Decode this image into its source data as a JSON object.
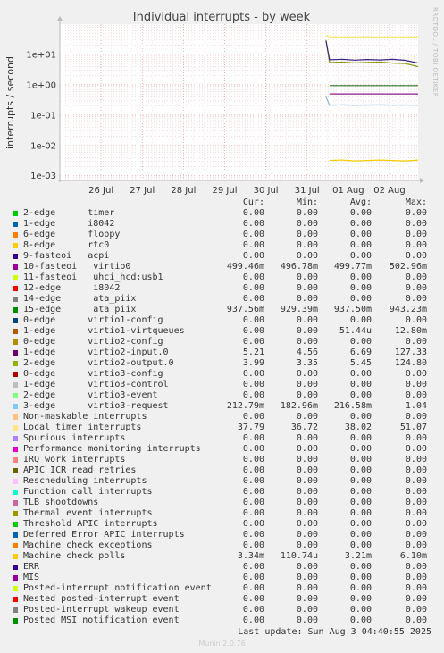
{
  "chart_data": {
    "type": "line",
    "title": "Individual interrupts - by week",
    "ylabel": "interrupts / second",
    "yscale": "log",
    "ylim": [
      0.0007,
      100
    ],
    "yticks": [
      {
        "v": 10,
        "label": "1e+01"
      },
      {
        "v": 1,
        "label": "1e+00"
      },
      {
        "v": 0.1,
        "label": "1e-01"
      },
      {
        "v": 0.01,
        "label": "1e-02"
      },
      {
        "v": 0.001,
        "label": "1e-03"
      }
    ],
    "xlim": [
      "2025-07-25T12:00",
      "2025-08-03T04:40"
    ],
    "xticks": [
      {
        "t": "2025-07-26T12:00",
        "label": "26 Jul"
      },
      {
        "t": "2025-07-27T12:00",
        "label": "27 Jul"
      },
      {
        "t": "2025-07-28T12:00",
        "label": "28 Jul"
      },
      {
        "t": "2025-07-29T12:00",
        "label": "29 Jul"
      },
      {
        "t": "2025-07-30T12:00",
        "label": "30 Jul"
      },
      {
        "t": "2025-07-31T12:00",
        "label": "31 Jul"
      },
      {
        "t": "2025-08-01T12:00",
        "label": "01 Aug"
      },
      {
        "t": "2025-08-02T12:00",
        "label": "02 Aug"
      }
    ],
    "grid": true,
    "series": [
      {
        "name": "Local timer interrupts",
        "color": "#f8e45c",
        "start": "2025-07-31T23:00",
        "peak": 43,
        "values": [
          37.8,
          38.0,
          37.9,
          38.1,
          37.9,
          38.0,
          38.0,
          37.8
        ]
      },
      {
        "name": "2-edge virtio2-output.0",
        "color": "#8a9a10",
        "start": "2025-07-31T23:00",
        "peak": 30,
        "values": [
          5.4,
          5.6,
          5.3,
          5.5,
          5.6,
          5.2,
          5.0,
          3.99
        ]
      },
      {
        "name": "1-edge virtio2-input.0",
        "color": "#3a2080",
        "start": "2025-07-31T23:00",
        "peak": 28,
        "values": [
          6.7,
          6.9,
          6.5,
          6.8,
          6.6,
          6.9,
          6.4,
          5.21
        ]
      },
      {
        "name": "15-edge ata_piix",
        "color": "#2a7a2a",
        "start": "2025-07-31T23:00",
        "values": [
          0.9375,
          0.9375,
          0.9375,
          0.9375
        ]
      },
      {
        "name": "10-fasteoi virtio0",
        "color": "#8c1a8c",
        "start": "2025-07-31T23:00",
        "values": [
          0.4998,
          0.4998,
          0.4998,
          0.4998
        ]
      },
      {
        "name": "3-edge virtio3-request",
        "color": "#7fb8e8",
        "start": "2025-07-31T23:00",
        "peak": 0.4,
        "values": [
          0.215,
          0.217,
          0.214,
          0.216,
          0.218,
          0.215,
          0.216,
          0.2128
        ]
      },
      {
        "name": "Machine check polls",
        "color": "#f8cc00",
        "start": "2025-07-31T23:00",
        "values": [
          0.0032,
          0.0033,
          0.0031,
          0.0032,
          0.0033,
          0.0032,
          0.0031,
          0.0033
        ]
      }
    ]
  },
  "legend": {
    "headers": [
      "Cur:",
      "Min:",
      "Avg:",
      "Max:"
    ],
    "rows": [
      {
        "color": "#00cc00",
        "name": "2-edge      timer",
        "cur": "0.00",
        "min": "0.00",
        "avg": "0.00",
        "max": "0.00"
      },
      {
        "color": "#0066b3",
        "name": "1-edge      i8042",
        "cur": "0.00",
        "min": "0.00",
        "avg": "0.00",
        "max": "0.00"
      },
      {
        "color": "#ff8000",
        "name": "6-edge      floppy",
        "cur": "0.00",
        "min": "0.00",
        "avg": "0.00",
        "max": "0.00"
      },
      {
        "color": "#ffcc00",
        "name": "8-edge      rtc0",
        "cur": "0.00",
        "min": "0.00",
        "avg": "0.00",
        "max": "0.00"
      },
      {
        "color": "#330099",
        "name": "9-fasteoi   acpi",
        "cur": "0.00",
        "min": "0.00",
        "avg": "0.00",
        "max": "0.00"
      },
      {
        "color": "#990099",
        "name": "10-fasteoi   virtio0",
        "cur": "499.46m",
        "min": "496.78m",
        "avg": "499.77m",
        "max": "502.96m"
      },
      {
        "color": "#ccff00",
        "name": "11-fasteoi   uhci_hcd:usb1",
        "cur": "0.00",
        "min": "0.00",
        "avg": "0.00",
        "max": "0.00"
      },
      {
        "color": "#ff0000",
        "name": "12-edge      i8042",
        "cur": "0.00",
        "min": "0.00",
        "avg": "0.00",
        "max": "0.00"
      },
      {
        "color": "#808080",
        "name": "14-edge      ata_piix",
        "cur": "0.00",
        "min": "0.00",
        "avg": "0.00",
        "max": "0.00"
      },
      {
        "color": "#008f00",
        "name": "15-edge      ata_piix",
        "cur": "937.56m",
        "min": "929.39m",
        "avg": "937.50m",
        "max": "943.23m"
      },
      {
        "color": "#00487d",
        "name": "0-edge      virtio1-config",
        "cur": "0.00",
        "min": "0.00",
        "avg": "0.00",
        "max": "0.00"
      },
      {
        "color": "#b35a00",
        "name": "1-edge      virtio1-virtqueues",
        "cur": "0.00",
        "min": "0.00",
        "avg": "51.44u",
        "max": "12.80m"
      },
      {
        "color": "#b38f00",
        "name": "0-edge      virtio2-config",
        "cur": "0.00",
        "min": "0.00",
        "avg": "0.00",
        "max": "0.00"
      },
      {
        "color": "#6b006b",
        "name": "1-edge      virtio2-input.0",
        "cur": "5.21",
        "min": "4.56",
        "avg": "6.69",
        "max": "127.33"
      },
      {
        "color": "#8fb300",
        "name": "2-edge      virtio2-output.0",
        "cur": "3.99",
        "min": "3.35",
        "avg": "5.45",
        "max": "124.80"
      },
      {
        "color": "#b30000",
        "name": "0-edge      virtio3-config",
        "cur": "0.00",
        "min": "0.00",
        "avg": "0.00",
        "max": "0.00"
      },
      {
        "color": "#bebebe",
        "name": "1-edge      virtio3-control",
        "cur": "0.00",
        "min": "0.00",
        "avg": "0.00",
        "max": "0.00"
      },
      {
        "color": "#80ff80",
        "name": "2-edge      virtio3-event",
        "cur": "0.00",
        "min": "0.00",
        "avg": "0.00",
        "max": "0.00"
      },
      {
        "color": "#80c9ff",
        "name": "3-edge      virtio3-request",
        "cur": "212.79m",
        "min": "182.96m",
        "avg": "216.58m",
        "max": "1.04"
      },
      {
        "color": "#ffc080",
        "name": "Non-maskable interrupts",
        "cur": "0.00",
        "min": "0.00",
        "avg": "0.00",
        "max": "0.00"
      },
      {
        "color": "#ffe680",
        "name": "Local timer interrupts",
        "cur": "37.79",
        "min": "36.72",
        "avg": "38.02",
        "max": "51.07"
      },
      {
        "color": "#aa80ff",
        "name": "Spurious interrupts",
        "cur": "0.00",
        "min": "0.00",
        "avg": "0.00",
        "max": "0.00"
      },
      {
        "color": "#ee00cc",
        "name": "Performance monitoring interrupts",
        "cur": "0.00",
        "min": "0.00",
        "avg": "0.00",
        "max": "0.00"
      },
      {
        "color": "#ff8080",
        "name": "IRQ work interrupts",
        "cur": "0.00",
        "min": "0.00",
        "avg": "0.00",
        "max": "0.00"
      },
      {
        "color": "#666600",
        "name": "APIC ICR read retries",
        "cur": "0.00",
        "min": "0.00",
        "avg": "0.00",
        "max": "0.00"
      },
      {
        "color": "#ffbfff",
        "name": "Rescheduling interrupts",
        "cur": "0.00",
        "min": "0.00",
        "avg": "0.00",
        "max": "0.00"
      },
      {
        "color": "#00ffcc",
        "name": "Function call interrupts",
        "cur": "0.00",
        "min": "0.00",
        "avg": "0.00",
        "max": "0.00"
      },
      {
        "color": "#cc6699",
        "name": "TLB shootdowns",
        "cur": "0.00",
        "min": "0.00",
        "avg": "0.00",
        "max": "0.00"
      },
      {
        "color": "#999900",
        "name": "Thermal event interrupts",
        "cur": "0.00",
        "min": "0.00",
        "avg": "0.00",
        "max": "0.00"
      },
      {
        "color": "#00cc00",
        "name": "Threshold APIC interrupts",
        "cur": "0.00",
        "min": "0.00",
        "avg": "0.00",
        "max": "0.00"
      },
      {
        "color": "#0066b3",
        "name": "Deferred Error APIC interrupts",
        "cur": "0.00",
        "min": "0.00",
        "avg": "0.00",
        "max": "0.00"
      },
      {
        "color": "#ff8000",
        "name": "Machine check exceptions",
        "cur": "0.00",
        "min": "0.00",
        "avg": "0.00",
        "max": "0.00"
      },
      {
        "color": "#ffcc00",
        "name": "Machine check polls",
        "cur": "3.34m",
        "min": "110.74u",
        "avg": "3.21m",
        "max": "6.10m"
      },
      {
        "color": "#330099",
        "name": "ERR",
        "cur": "0.00",
        "min": "0.00",
        "avg": "0.00",
        "max": "0.00"
      },
      {
        "color": "#990099",
        "name": "MIS",
        "cur": "0.00",
        "min": "0.00",
        "avg": "0.00",
        "max": "0.00"
      },
      {
        "color": "#ccff00",
        "name": "Posted-interrupt notification event",
        "cur": "0.00",
        "min": "0.00",
        "avg": "0.00",
        "max": "0.00"
      },
      {
        "color": "#ff0000",
        "name": "Nested posted-interrupt event",
        "cur": "0.00",
        "min": "0.00",
        "avg": "0.00",
        "max": "0.00"
      },
      {
        "color": "#808080",
        "name": "Posted-interrupt wakeup event",
        "cur": "0.00",
        "min": "0.00",
        "avg": "0.00",
        "max": "0.00"
      },
      {
        "color": "#008f00",
        "name": "Posted MSI notification event",
        "cur": "0.00",
        "min": "0.00",
        "avg": "0.00",
        "max": "0.00"
      }
    ]
  },
  "last_update": "Last update: Sun Aug  3 04:40:55 2025",
  "footer": "Munin 2.0.76",
  "watermark": "RRDTOOL / TOBI OETIKER"
}
